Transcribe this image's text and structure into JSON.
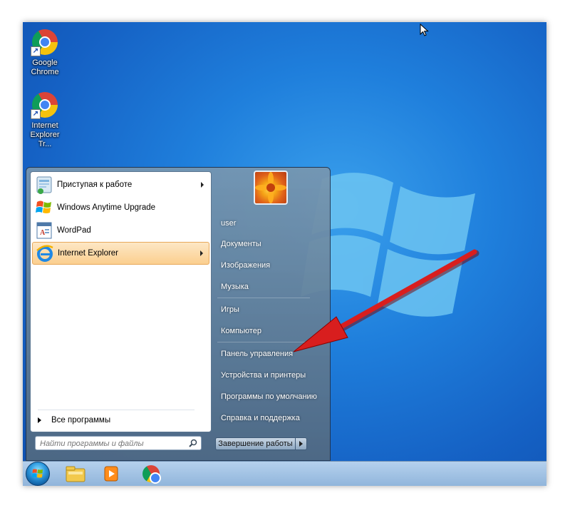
{
  "desktop": {
    "icons": [
      {
        "label": "Google Chrome",
        "icon": "chrome-icon"
      },
      {
        "label": "Internet Explorer Tr...",
        "icon": "chrome-icon"
      }
    ]
  },
  "start_menu": {
    "programs": [
      {
        "label": "Приступая к работе",
        "icon": "getting-started-icon",
        "has_submenu": true
      },
      {
        "label": "Windows Anytime Upgrade",
        "icon": "windows-flag-icon",
        "has_submenu": false
      },
      {
        "label": "WordPad",
        "icon": "wordpad-icon",
        "has_submenu": false
      },
      {
        "label": "Internet Explorer",
        "icon": "internet-explorer-icon",
        "has_submenu": true,
        "selected": true
      }
    ],
    "all_programs": "Все программы",
    "search": {
      "placeholder": "Найти программы и файлы"
    },
    "right_items": [
      {
        "label": "user"
      },
      {
        "label": "Документы"
      },
      {
        "label": "Изображения"
      },
      {
        "label": "Музыка"
      },
      {
        "label": "Игры"
      },
      {
        "label": "Компьютер"
      },
      {
        "label": "Панель управления"
      },
      {
        "label": "Устройства и принтеры"
      },
      {
        "label": "Программы по умолчанию"
      },
      {
        "label": "Справка и поддержка"
      }
    ],
    "shutdown_label": "Завершение работы"
  },
  "taskbar": {
    "pinned": [
      "explorer-folder-icon",
      "media-player-icon",
      "chrome-icon"
    ]
  },
  "colors": {
    "annotation_arrow": "#d81e1e",
    "selected_item": "#fbcf8f"
  }
}
